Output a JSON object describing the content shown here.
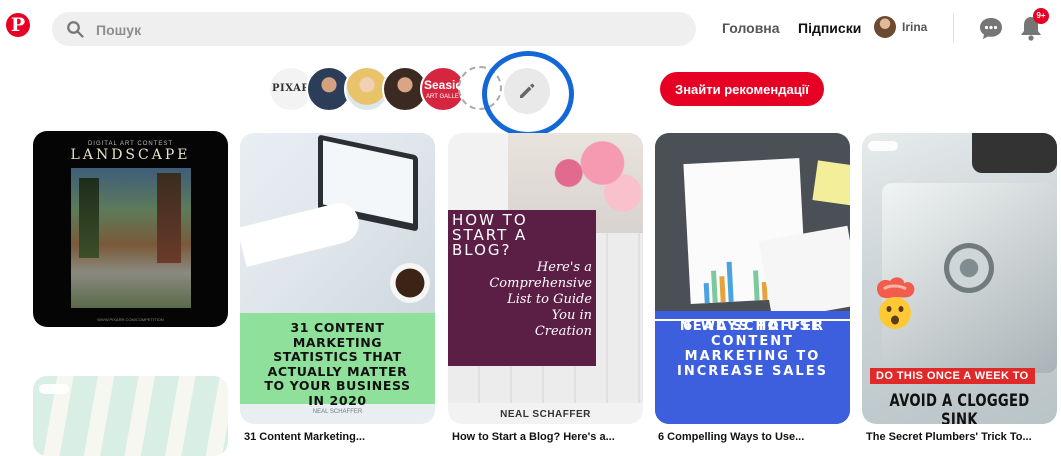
{
  "header": {
    "logo_letter": "P",
    "search_placeholder": "Пошук",
    "nav_home": "Головна",
    "nav_following": "Підписки",
    "profile_name": "Irina",
    "notifications_badge": "9+"
  },
  "following": {
    "items": [
      {
        "name": "PIXARR",
        "label": "PIXARR"
      },
      {
        "name": "person-2"
      },
      {
        "name": "person-3"
      },
      {
        "name": "person-4"
      },
      {
        "name": "seaside",
        "label": "Seasid",
        "sublabel": "ART GALLE"
      }
    ],
    "edit_icon": "pencil-icon",
    "recommend_button": "Знайти рекомендації"
  },
  "pins": [
    {
      "id": "landscape",
      "top_small": "DIGITAL ART CONTEST",
      "top_big": "LANDSCAPE",
      "footer": "WWW.PIXARR.COM/COMPETITION"
    },
    {
      "id": "content-marketing",
      "overlay": "31 CONTENT\nMARKETING\nSTATISTICS THAT\nACTUALLY MATTER\nTO YOUR BUSINESS\nIN 2020",
      "credit": "NEAL SCHAFFER",
      "title": "31 Content Marketing..."
    },
    {
      "id": "blog",
      "overlay_title": "HOW TO\nSTART A\nBLOG?",
      "overlay_script": "Here's a\nComprehensive\nList to Guide\nYou in\nCreation",
      "credit": "NEAL SCHAFFER",
      "title": "How to Start a Blog? Here's a..."
    },
    {
      "id": "sales",
      "overlay": "6 WAYS TO USE\nCONTENT\nMARKETING TO\nINCREASE SALES",
      "credit": "NEAL SCHAFFER",
      "title": "6 Compelling Ways to Use..."
    },
    {
      "id": "sink",
      "tag": "DO THIS ONCE A WEEK TO",
      "big": "AVOID A CLOGGED SINK",
      "title": "The Secret Plumbers' Trick To..."
    },
    {
      "id": "striped"
    }
  ],
  "colors": {
    "brand": "#e60023",
    "highlight_circle": "#1467d6"
  }
}
